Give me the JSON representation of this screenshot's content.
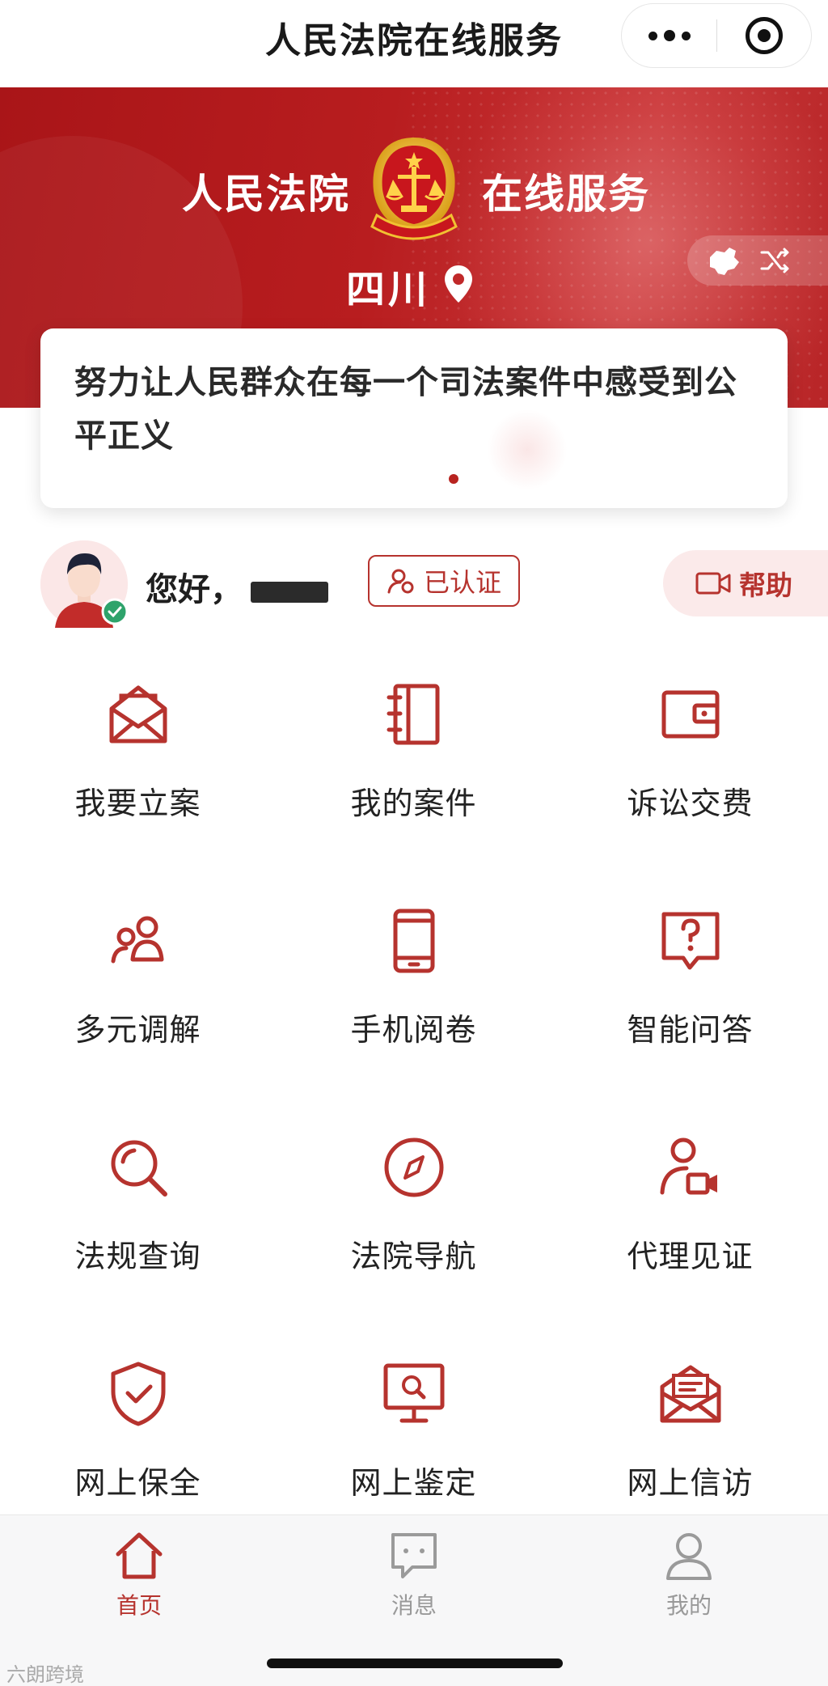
{
  "nav": {
    "title": "人民法院在线服务"
  },
  "banner": {
    "brand_left": "人民法院",
    "brand_right": "在线服务",
    "region": "四川",
    "colors": {
      "primary": "#b81d1f",
      "accent": "#f1c232"
    }
  },
  "slogan": {
    "text": "努力让人民群众在每一个司法案件中感受到公平正义"
  },
  "user": {
    "greeting": "您好，",
    "verified_label": "已认证",
    "help_label": "帮助"
  },
  "services": [
    {
      "label": "我要立案",
      "icon": "envelope-open-icon"
    },
    {
      "label": "我的案件",
      "icon": "notebook-icon"
    },
    {
      "label": "诉讼交费",
      "icon": "wallet-icon"
    },
    {
      "label": "多元调解",
      "icon": "people-icon"
    },
    {
      "label": "手机阅卷",
      "icon": "mobile-icon"
    },
    {
      "label": "智能问答",
      "icon": "question-bubble-icon"
    },
    {
      "label": "法规查询",
      "icon": "search-icon"
    },
    {
      "label": "法院导航",
      "icon": "compass-icon"
    },
    {
      "label": "代理见证",
      "icon": "user-video-icon"
    },
    {
      "label": "网上保全",
      "icon": "shield-check-icon"
    },
    {
      "label": "网上鉴定",
      "icon": "monitor-search-icon"
    },
    {
      "label": "网上信访",
      "icon": "letter-icon"
    }
  ],
  "tabs": [
    {
      "label": "首页",
      "icon": "home-icon",
      "active": true
    },
    {
      "label": "消息",
      "icon": "message-icon",
      "active": false
    },
    {
      "label": "我的",
      "icon": "profile-icon",
      "active": false
    }
  ],
  "watermark": "六朗跨境"
}
